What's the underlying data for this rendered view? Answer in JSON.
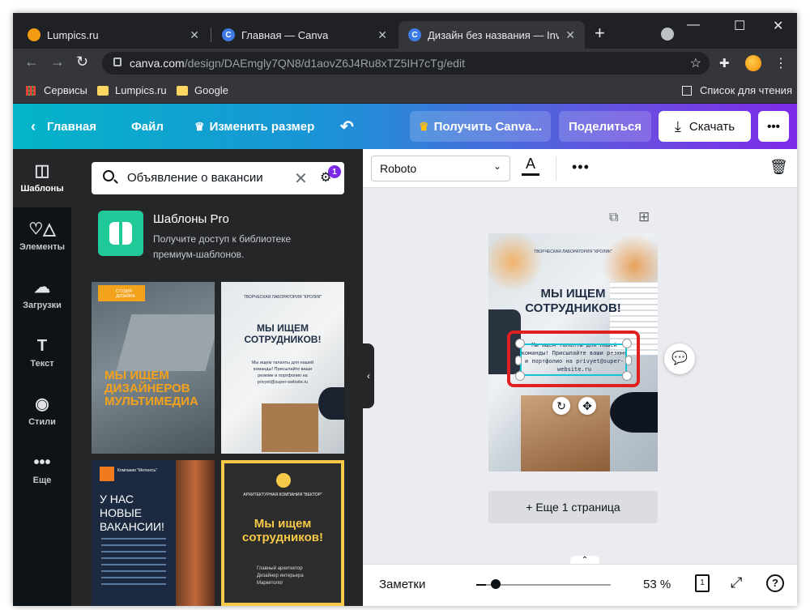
{
  "browser": {
    "tabs": [
      {
        "title": "Lumpics.ru",
        "favicon": "lumpics-icon",
        "active": false
      },
      {
        "title": "Главная — Canva",
        "favicon": "canva-icon",
        "active": false
      },
      {
        "title": "Дизайн без названия — Invitat",
        "favicon": "canva-icon",
        "active": true
      }
    ],
    "new_tab": "+",
    "url_host": "canva.com",
    "url_path": "/design/DAEmgly7QN8/d1aovZ6J4Ru8xTZ5IH7cTg/edit",
    "bookmarks": [
      "Сервисы",
      "Lumpics.ru",
      "Google"
    ],
    "reading_list": "Список для чтения"
  },
  "canva_header": {
    "home": "Главная",
    "file": "Файл",
    "resize": "Изменить размер",
    "get_pro": "Получить Canva...",
    "share": "Поделиться",
    "download": "Скачать",
    "more": "•••"
  },
  "sidebar": {
    "items": [
      {
        "label": "Шаблоны",
        "icon": "templates-icon",
        "glyph": "◫"
      },
      {
        "label": "Элементы",
        "icon": "elements-icon",
        "glyph": "♡△"
      },
      {
        "label": "Загрузки",
        "icon": "upload-icon",
        "glyph": "☁"
      },
      {
        "label": "Текст",
        "icon": "text-icon",
        "glyph": "T"
      },
      {
        "label": "Стили",
        "icon": "styles-icon",
        "glyph": "◉"
      },
      {
        "label": "Еще",
        "icon": "more-icon",
        "glyph": "•••"
      }
    ]
  },
  "panel": {
    "search_value": "Объявление о вакансии",
    "filter_badge": "1",
    "pro_title": "Шаблоны Pro",
    "pro_desc": "Получите доступ к библиотеке премиум-шаблонов.",
    "templates": [
      {
        "title": "МЫ ИЩЕМ ДИЗАЙНЕРОВ МУЛЬТИМЕДИА",
        "tag": "СТУДИЯ ДИЗАЙНА"
      },
      {
        "title": "МЫ ИЩЕМ СОТРУДНИКОВ!",
        "org": "ТВОРЧЕСКАЯ ЛАБОРАТОРИЯ \"КРОЛИК\"",
        "body": "Мы ищем таланты для нашей команды! Присылайте ваши резюме и портфолио на privyet@super-website.ru"
      },
      {
        "title": "У НАС НОВЫЕ ВАКАНСИИ!",
        "org": "Компания \"Метенгсь\""
      },
      {
        "title": "Мы ищем сотрудников!",
        "org": "АРХИТЕКТУРНАЯ КОМПАНИЯ \"ВЕКТОР\"",
        "body": "Главный архитектор Дизайнер интерьера Маркетолог"
      }
    ]
  },
  "editor": {
    "font": "Roboto",
    "page_org": "ТВОРЧЕСКАЯ ЛАБОРАТОРИЯ \"КРОЛИК\"",
    "page_title": "МЫ ИЩЕМ СОТРУДНИКОВ!",
    "page_body": "Мы ищем таланты для нашей команды! Присылайте ваши резюме и портфолио на privyet@super-website.ru",
    "add_page": "+ Еще 1 страница",
    "notes": "Заметки",
    "zoom": "53 %",
    "page_count": "1",
    "help": "?"
  },
  "colors": {
    "accent_purple": "#7d2ae8",
    "accent_teal": "#03b5c8",
    "selection_red": "#e02020",
    "selection_cyan": "#13c4d4"
  }
}
